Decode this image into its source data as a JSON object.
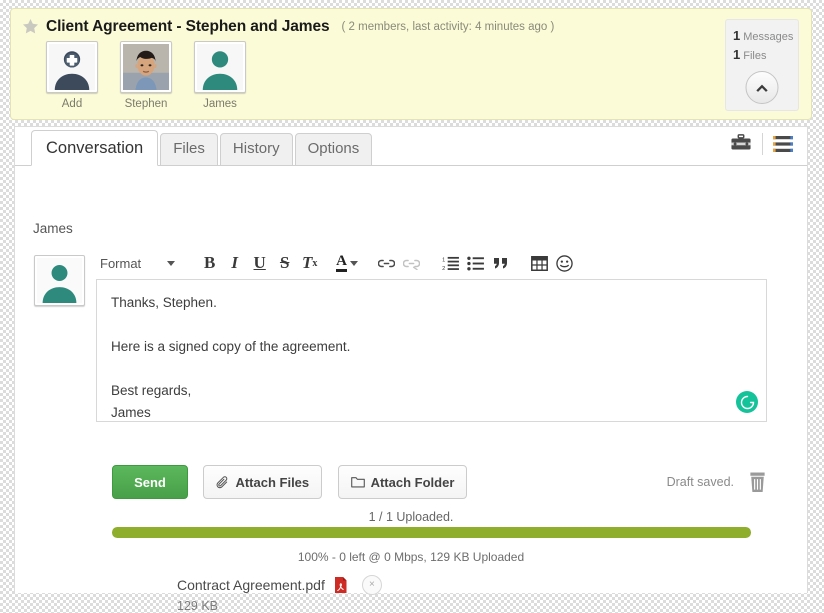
{
  "header": {
    "title": "Client Agreement - Stephen and James",
    "meta": "( 2 members, last activity: 4 minutes ago )",
    "star_icon": "star-icon",
    "members": [
      {
        "label": "Add",
        "type": "add-placeholder"
      },
      {
        "label": "Stephen",
        "type": "photo"
      },
      {
        "label": "James",
        "type": "silhouette"
      }
    ],
    "counts": {
      "messages_num": "1",
      "messages_label": "Messages",
      "files_num": "1",
      "files_label": "Files",
      "collapse_icon": "chevron-up-icon"
    }
  },
  "tabs": [
    {
      "label": "Conversation",
      "active": true
    },
    {
      "label": "Files",
      "active": false
    },
    {
      "label": "History",
      "active": false
    },
    {
      "label": "Options",
      "active": false
    }
  ],
  "tab_tools": [
    {
      "name": "toolbox-icon"
    },
    {
      "name": "menu-list-icon"
    }
  ],
  "composer": {
    "sender": "James",
    "avatar_icon": "user-silhouette-icon",
    "toolbar": {
      "format_label": "Format",
      "bold": "B",
      "italic": "I",
      "underline": "U",
      "strikethrough": "S",
      "remove_format": "Tx",
      "text_color": "A",
      "link": "link-icon",
      "unlink": "unlink-icon",
      "numbered_list": "numbered-list-icon",
      "bulleted_list": "bulleted-list-icon",
      "blockquote": "blockquote-icon",
      "table": "table-icon",
      "emoji": "emoji-icon"
    },
    "body": "Thanks, Stephen.\n\nHere is a signed copy of the agreement.\n\nBest regards,\nJames",
    "grammarly_badge": "G"
  },
  "actions": {
    "send_label": "Send",
    "attach_files_label": "Attach Files",
    "attach_folder_label": "Attach Folder",
    "draft_status": "Draft saved.",
    "delete_icon": "trash-icon"
  },
  "upload": {
    "status": "1 / 1 Uploaded.",
    "progress_percent": 100,
    "detail": "100% - 0 left @ 0 Mbps, 129 KB Uploaded",
    "file": {
      "name": "Contract Agreement.pdf",
      "size": "129 KB",
      "type_icon": "pdf-file-icon",
      "remove_label": "×"
    }
  },
  "colors": {
    "header_bg": "#fbfbd8",
    "send_button": "#4fa64f",
    "progress_fill": "#8fae2b",
    "accent_pdf": "#cf2b25",
    "grammarly_green": "#15c39a",
    "avatar_teal": "#2f8a7e"
  }
}
